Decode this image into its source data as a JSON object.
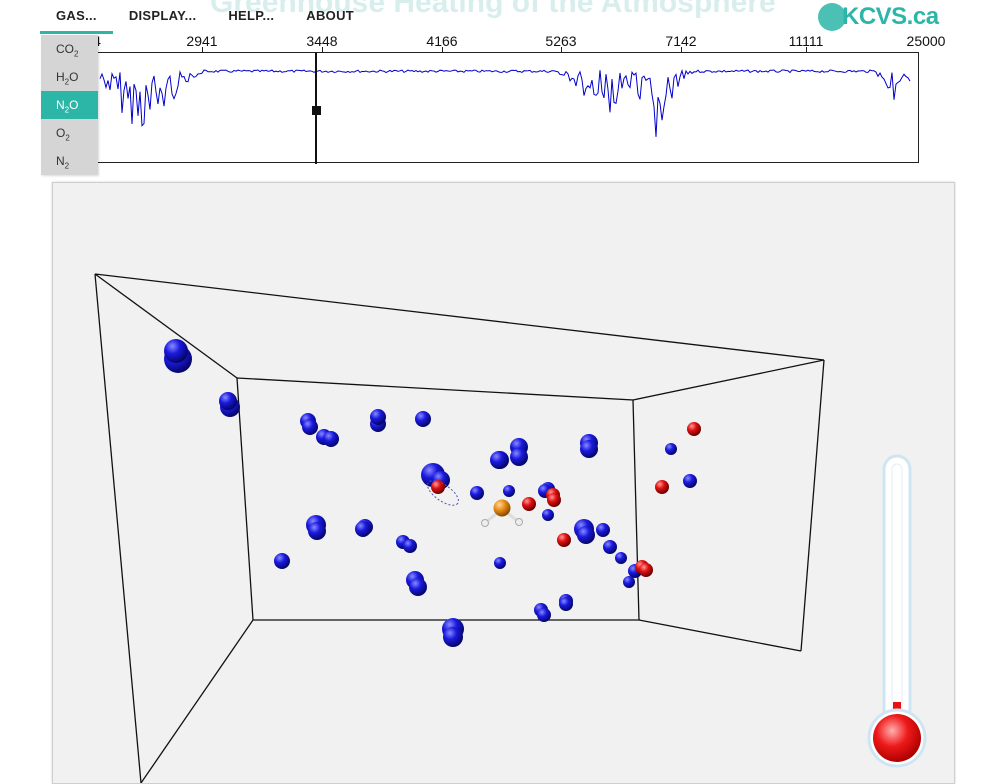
{
  "header": {
    "title": "Greenhouse Heating of the Atmosphere",
    "logo": "KCVS.ca"
  },
  "menu": {
    "items": [
      {
        "label": "GAS...",
        "active": true
      },
      {
        "label": "DISPLAY...",
        "active": false
      },
      {
        "label": "HELP...",
        "active": false
      },
      {
        "label": "ABOUT",
        "active": false
      }
    ]
  },
  "gas_menu": {
    "options": [
      {
        "base": "CO",
        "sub": "2",
        "selected": false
      },
      {
        "base": "H",
        "sub": "2",
        "tail": "O",
        "selected": false
      },
      {
        "base": "N",
        "sub": "2",
        "tail": "O",
        "selected": true
      },
      {
        "base": "O",
        "sub": "2",
        "selected": false
      },
      {
        "base": "N",
        "sub": "2",
        "selected": false
      }
    ]
  },
  "spectrum": {
    "tick_labels": [
      "2941",
      "3448",
      "4166",
      "5263",
      "7142",
      "11111",
      "25000"
    ],
    "partial_label": "4",
    "line_color": "#0000cc",
    "marker_label": "3448"
  },
  "simulation": {
    "n2_color": "#1a1adf",
    "o2_color": "#e01010",
    "n2o_highlight_color": "#e58a10",
    "thermometer_color": "#e81010"
  }
}
